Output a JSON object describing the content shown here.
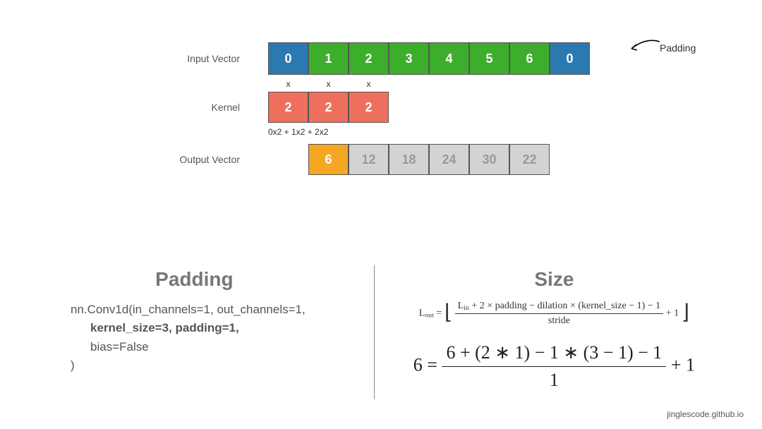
{
  "labels": {
    "input": "Input Vector",
    "kernel": "Kernel",
    "output": "Output Vector",
    "padding_annotation": "Padding"
  },
  "input_cells": [
    "0",
    "1",
    "2",
    "3",
    "4",
    "5",
    "6",
    "0"
  ],
  "input_padding_indices": [
    0,
    7
  ],
  "x_marks": [
    "x",
    "x",
    "x"
  ],
  "kernel_cells": [
    "2",
    "2",
    "2"
  ],
  "calc": "0x2 + 1x2 + 2x2",
  "output_cells": [
    "6",
    "12",
    "18",
    "24",
    "30",
    "22"
  ],
  "output_highlight_index": 0,
  "bottom": {
    "left_title": "Padding",
    "right_title": "Size",
    "code_line1": "nn.Conv1d(in_channels=1, out_channels=1,",
    "code_line2": "kernel_size=3, padding=1,",
    "code_line3": "bias=False",
    "code_line4": ")",
    "formula_small_lhs": "L",
    "formula_small_lhs_sub": "out",
    "formula_small_eq": "=",
    "formula_small_num_a": "L",
    "formula_small_num_a_sub": "in",
    "formula_small_num_rest": " + 2 × padding − dilation × (kernel_size − 1) − 1",
    "formula_small_den": "stride",
    "formula_small_plus1": "+ 1",
    "formula_big_lhs": "6 =",
    "formula_big_num": "6 + (2 ∗ 1) − 1 ∗ (3 − 1) − 1",
    "formula_big_den": "1",
    "formula_big_plus1": "+ 1"
  },
  "credit": "jinglescode.github.io"
}
